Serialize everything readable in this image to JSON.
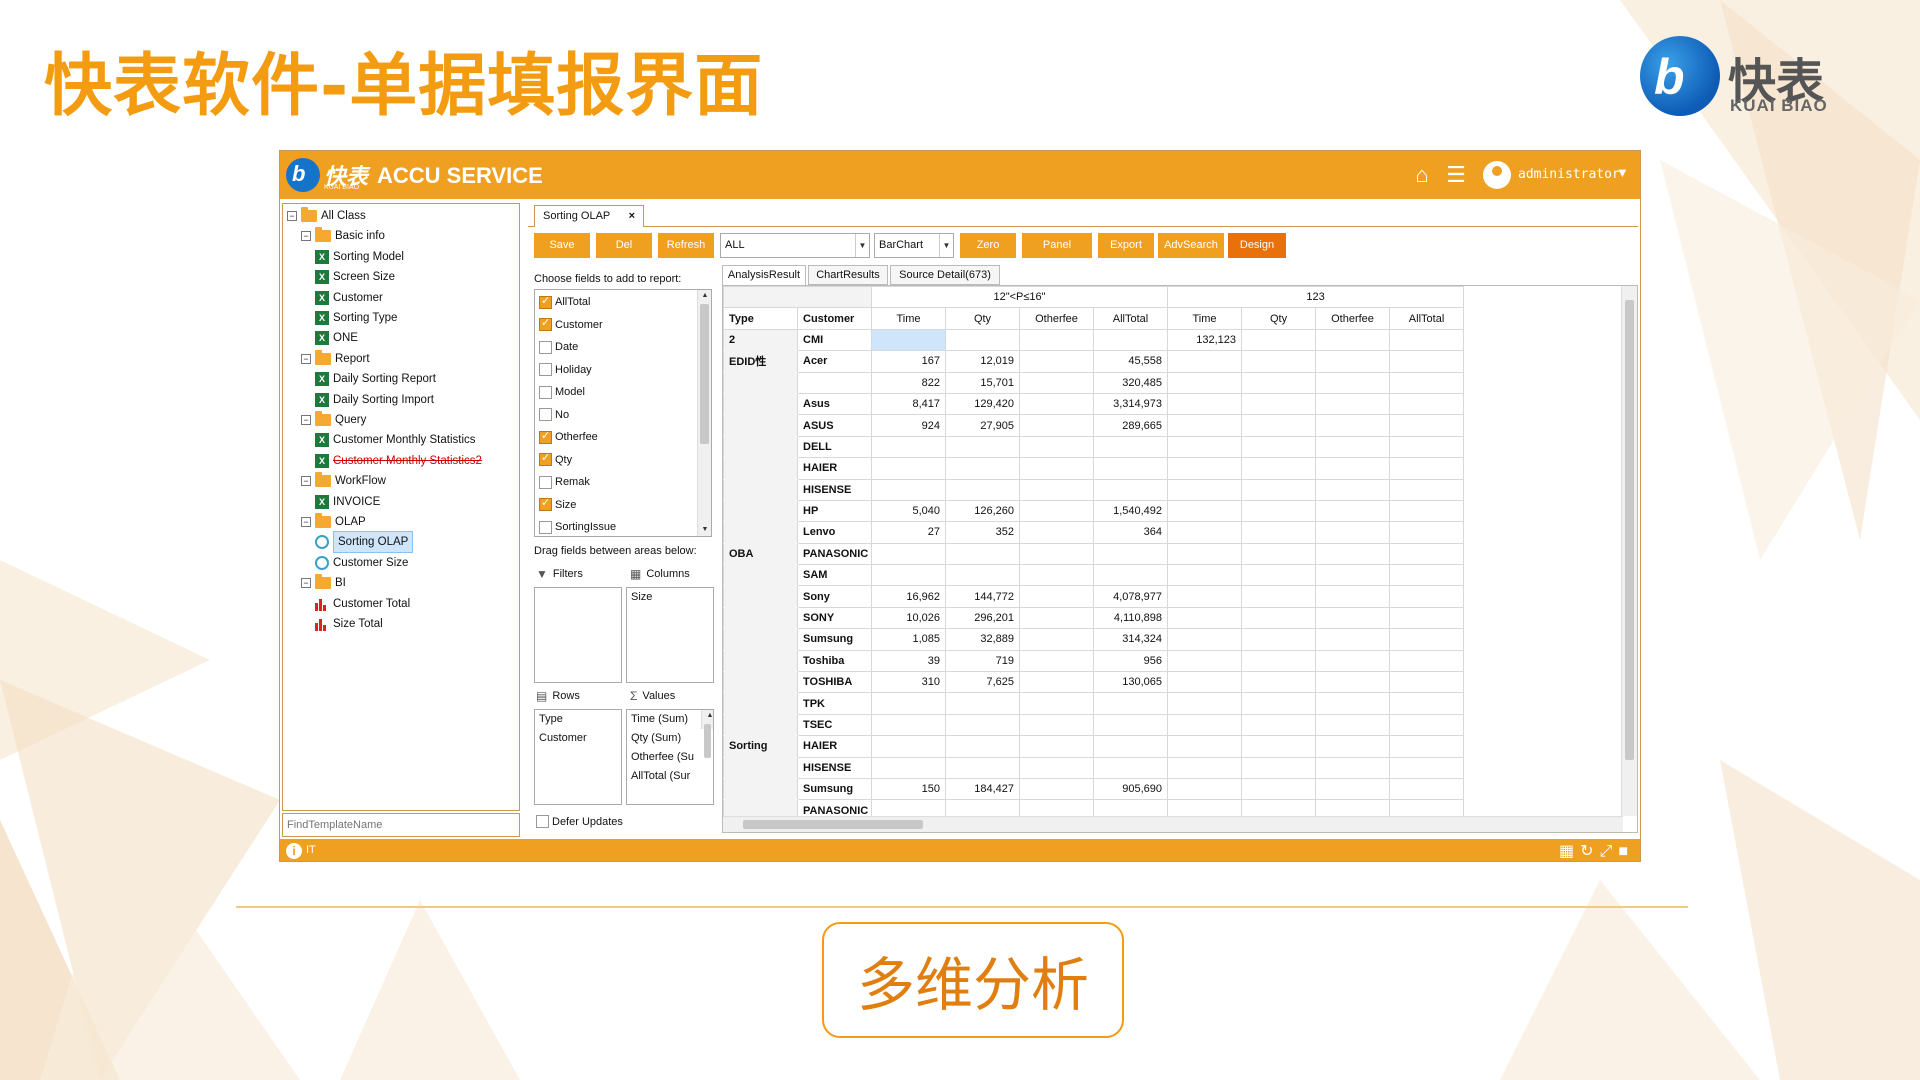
{
  "slide": {
    "title": "快表软件-单据填报界面",
    "logo_cn": "快表",
    "logo_en": "KUAI BIAO",
    "caption": "多维分析"
  },
  "app": {
    "logo_cn": "快表",
    "logo_en": "KUAI BIAO",
    "title": "ACCU SERVICE",
    "user": "administrator",
    "status_text": "IT",
    "accent": "#f0a020"
  },
  "tree": {
    "search_placeholder": "FindTemplateName",
    "nodes": [
      {
        "label": "All Class",
        "level": 0,
        "type": "folder",
        "toggle": "−"
      },
      {
        "label": "Basic info",
        "level": 1,
        "type": "folder",
        "toggle": "−"
      },
      {
        "label": "Sorting Model",
        "level": 2,
        "type": "xls"
      },
      {
        "label": "Screen Size",
        "level": 2,
        "type": "xls"
      },
      {
        "label": "Customer",
        "level": 2,
        "type": "xls"
      },
      {
        "label": "Sorting Type",
        "level": 2,
        "type": "xls"
      },
      {
        "label": "ONE",
        "level": 2,
        "type": "xls"
      },
      {
        "label": "Report",
        "level": 1,
        "type": "folder",
        "toggle": "−"
      },
      {
        "label": "Daily Sorting Report",
        "level": 2,
        "type": "xls"
      },
      {
        "label": "Daily Sorting Import",
        "level": 2,
        "type": "xls"
      },
      {
        "label": "Query",
        "level": 1,
        "type": "folder",
        "toggle": "−"
      },
      {
        "label": "Customer Monthly Statistics",
        "level": 2,
        "type": "xls"
      },
      {
        "label": "Customer Monthly Statistics2",
        "level": 2,
        "type": "xls",
        "strike": true
      },
      {
        "label": "WorkFlow",
        "level": 1,
        "type": "folder",
        "toggle": "−"
      },
      {
        "label": "INVOICE",
        "level": 2,
        "type": "xls"
      },
      {
        "label": "OLAP",
        "level": 1,
        "type": "folder",
        "toggle": "−"
      },
      {
        "label": "Sorting OLAP",
        "level": 2,
        "type": "olap",
        "selected": true
      },
      {
        "label": "Customer Size",
        "level": 2,
        "type": "olap"
      },
      {
        "label": "BI",
        "level": 1,
        "type": "folder",
        "toggle": "−"
      },
      {
        "label": "Customer Total",
        "level": 2,
        "type": "bar"
      },
      {
        "label": "Size Total",
        "level": 2,
        "type": "bar"
      }
    ]
  },
  "doc_tab": {
    "label": "Sorting OLAP",
    "close": "×"
  },
  "toolbar": {
    "save": "Save",
    "del": "Del",
    "refresh": "Refresh",
    "filter_value": "ALL",
    "chart_value": "BarChart",
    "zero": "Zero",
    "panel": "Panel",
    "export": "Export",
    "advsearch": "AdvSearch",
    "design": "Design"
  },
  "chooser": {
    "label": "Choose fields to add to report:",
    "fields": [
      {
        "label": "AllTotal",
        "checked": true
      },
      {
        "label": "Customer",
        "checked": true
      },
      {
        "label": "Date",
        "checked": false
      },
      {
        "label": "Holiday",
        "checked": false
      },
      {
        "label": "Model",
        "checked": false
      },
      {
        "label": "No",
        "checked": false
      },
      {
        "label": "Otherfee",
        "checked": true
      },
      {
        "label": "Qty",
        "checked": true
      },
      {
        "label": "Remak",
        "checked": false
      },
      {
        "label": "Size",
        "checked": true
      },
      {
        "label": "SortingIssue",
        "checked": false
      }
    ],
    "drag_label": "Drag fields between areas below:",
    "filters_label": "Filters",
    "columns_label": "Columns",
    "rows_label": "Rows",
    "values_label": "Values",
    "filters": [],
    "columns": [
      "Size"
    ],
    "rows": [
      "Type",
      "Customer"
    ],
    "values": [
      "Time (Sum)",
      "Qty (Sum)",
      "Otherfee (Su",
      "AllTotal (Sur"
    ],
    "defer_label": "Defer Updates"
  },
  "result_tabs": [
    "AnalysisResult",
    "ChartResults",
    "Source Detail(673)"
  ],
  "pivot": {
    "group1": "12\"<P≤16\"",
    "group2": "123",
    "headers": [
      "Type",
      "Customer",
      "Time",
      "Qty",
      "Otherfee",
      "AllTotal",
      "Time",
      "Qty",
      "Otherfee",
      "AllTotal"
    ],
    "rows": [
      [
        "2",
        "CMI",
        "",
        "",
        "",
        "",
        "132,123",
        "",
        "",
        ""
      ],
      [
        "EDID性",
        "Acer",
        "167",
        "12,019",
        "",
        "45,558",
        "",
        "",
        "",
        ""
      ],
      [
        "",
        "",
        "822",
        "15,701",
        "",
        "320,485",
        "",
        "",
        "",
        ""
      ],
      [
        "",
        "Asus",
        "8,417",
        "129,420",
        "",
        "3,314,973",
        "",
        "",
        "",
        ""
      ],
      [
        "",
        "ASUS",
        "924",
        "27,905",
        "",
        "289,665",
        "",
        "",
        "",
        ""
      ],
      [
        "",
        "DELL",
        "",
        "",
        "",
        "",
        "",
        "",
        "",
        ""
      ],
      [
        "",
        "HAIER",
        "",
        "",
        "",
        "",
        "",
        "",
        "",
        ""
      ],
      [
        "",
        "HISENSE",
        "",
        "",
        "",
        "",
        "",
        "",
        "",
        ""
      ],
      [
        "",
        "HP",
        "5,040",
        "126,260",
        "",
        "1,540,492",
        "",
        "",
        "",
        ""
      ],
      [
        "",
        "Lenvo",
        "27",
        "352",
        "",
        "364",
        "",
        "",
        "",
        ""
      ],
      [
        "OBA",
        "PANASONIC",
        "",
        "",
        "",
        "",
        "",
        "",
        "",
        ""
      ],
      [
        "",
        "SAM",
        "",
        "",
        "",
        "",
        "",
        "",
        "",
        ""
      ],
      [
        "",
        "Sony",
        "16,962",
        "144,772",
        "",
        "4,078,977",
        "",
        "",
        "",
        ""
      ],
      [
        "",
        "SONY",
        "10,026",
        "296,201",
        "",
        "4,110,898",
        "",
        "",
        "",
        ""
      ],
      [
        "",
        "Sumsung",
        "1,085",
        "32,889",
        "",
        "314,324",
        "",
        "",
        "",
        ""
      ],
      [
        "",
        "Toshiba",
        "39",
        "719",
        "",
        "956",
        "",
        "",
        "",
        ""
      ],
      [
        "",
        "TOSHIBA",
        "310",
        "7,625",
        "",
        "130,065",
        "",
        "",
        "",
        ""
      ],
      [
        "",
        "TPK",
        "",
        "",
        "",
        "",
        "",
        "",
        "",
        ""
      ],
      [
        "",
        "TSEC",
        "",
        "",
        "",
        "",
        "",
        "",
        "",
        ""
      ],
      [
        "Sorting",
        "HAIER",
        "",
        "",
        "",
        "",
        "",
        "",
        "",
        ""
      ],
      [
        "",
        "HISENSE",
        "",
        "",
        "",
        "",
        "",
        "",
        "",
        ""
      ],
      [
        "",
        "Sumsung",
        "150",
        "184,427",
        "",
        "905,690",
        "",
        "",
        "",
        ""
      ],
      [
        "",
        "PANASONIC",
        "",
        "",
        "",
        "",
        "",
        "",
        "",
        ""
      ]
    ]
  }
}
